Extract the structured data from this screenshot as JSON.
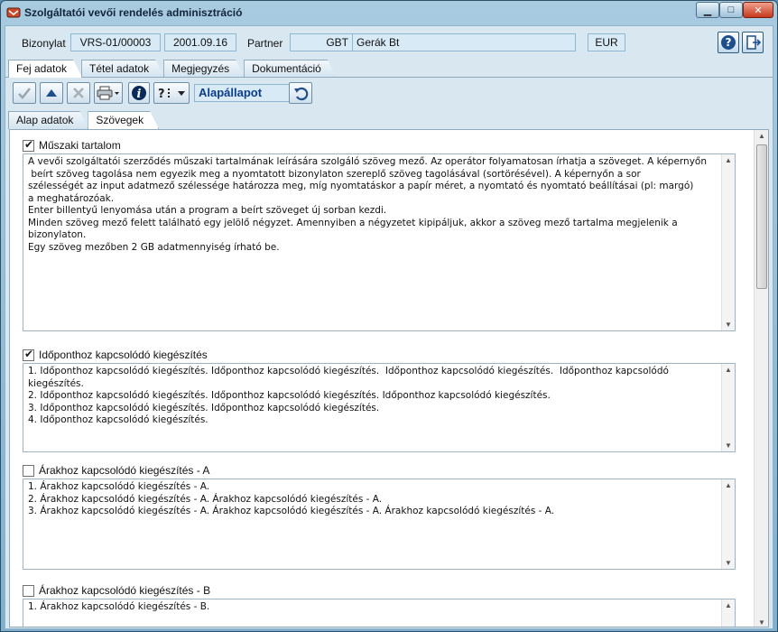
{
  "window": {
    "title": "Szolgáltatói vevői rendelés adminisztráció"
  },
  "header": {
    "doc_label": "Bizonylat",
    "doc_number": "VRS-01/00003",
    "doc_date": "2001.09.16",
    "partner_label": "Partner",
    "partner_code": "GBT",
    "partner_name": "Gerák Bt",
    "currency": "EUR"
  },
  "main_tabs": [
    {
      "label": "Fej adatok",
      "active": true
    },
    {
      "label": "Tétel adatok",
      "active": false
    },
    {
      "label": "Megjegyzés",
      "active": false
    },
    {
      "label": "Dokumentáció",
      "active": false
    }
  ],
  "toolbar": {
    "state": "Alapállapot"
  },
  "sub_tabs": [
    {
      "label": "Alap adatok",
      "active": false
    },
    {
      "label": "Szövegek",
      "active": true
    }
  ],
  "sections": [
    {
      "label": "Műszaki tartalom",
      "checked": true,
      "text": "A vevői szolgáltatói szerződés műszaki tartalmának leírására szolgáló szöveg mező. Az operátor folyamatosan írhatja a szöveget. A képernyőn\n beírt szöveg tagolása nem egyezik meg a nyomtatott bizonylaton szereplő szöveg tagolásával (sortörésével). A képernyőn a sor\nszélességét az input adatmező szélessége határozza meg, míg nyomtatáskor a papír méret, a nyomtató és nyomtató beállításai (pl: margó)\na meghatározóak.\nEnter billentyű lenyomása után a program a beírt szöveget új sorban kezdi.\nMinden szöveg mező felett található egy jelölő négyzet. Amennyiben a négyzetet kipipáljuk, akkor a szöveg mező tartalma megjelenik a\nbizonylaton.\nEgy szöveg mezőben 2 GB adatmennyiség írható be."
    },
    {
      "label": "Időponthoz kapcsolódó kiegészítés",
      "checked": true,
      "text": "1. Időponthoz kapcsolódó kiegészítés. Időponthoz kapcsolódó kiegészítés.  Időponthoz kapcsolódó kiegészítés.  Időponthoz kapcsolódó\nkiegészítés.\n2. Időponthoz kapcsolódó kiegészítés. Időponthoz kapcsolódó kiegészítés. Időponthoz kapcsolódó kiegészítés.\n3. Időponthoz kapcsolódó kiegészítés. Időponthoz kapcsolódó kiegészítés.\n4. Időponthoz kapcsolódó kiegészítés."
    },
    {
      "label": "Árakhoz kapcsolódó kiegészítés - A",
      "checked": false,
      "text": "1. Árakhoz kapcsolódó kiegészítés - A.\n2. Árakhoz kapcsolódó kiegészítés - A. Árakhoz kapcsolódó kiegészítés - A.\n3. Árakhoz kapcsolódó kiegészítés - A. Árakhoz kapcsolódó kiegészítés - A. Árakhoz kapcsolódó kiegészítés - A."
    },
    {
      "label": "Árakhoz kapcsolódó kiegészítés - B",
      "checked": false,
      "text": "1. Árakhoz kapcsolódó kiegészítés - B."
    }
  ],
  "icons": {
    "ok": "check-icon",
    "up": "arrow-up-icon",
    "delete": "x-icon",
    "print": "printer-icon",
    "info": "info-icon",
    "help_menu": "question-menu-icon",
    "undo": "undo-icon",
    "help": "help-icon",
    "exit": "exit-door-icon"
  },
  "colors": {
    "state_text": "#0c3d8c",
    "field_bg": "#d7eaf6",
    "client_bg": "#d9e7f1"
  }
}
